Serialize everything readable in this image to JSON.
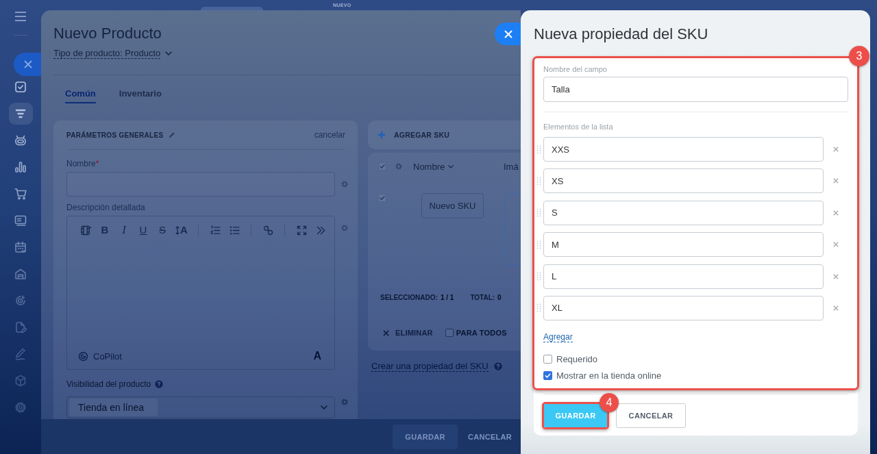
{
  "sidebar": {
    "items": [
      {
        "selected": false
      },
      {
        "selected": true
      },
      {
        "selected": false
      },
      {
        "selected": false
      },
      {
        "selected": false
      },
      {
        "selected": false
      },
      {
        "selected": false
      },
      {
        "selected": false
      },
      {
        "selected": false
      },
      {
        "selected": false
      },
      {
        "selected": false
      },
      {
        "selected": false
      },
      {
        "selected": false
      }
    ]
  },
  "top_bar": {
    "label": "NUEVO"
  },
  "product_form": {
    "title": "Nuevo Producto",
    "type_selector": "Tipo de producto: Producto",
    "tabs": [
      {
        "label": "Común",
        "selected": true
      },
      {
        "label": "Inventario",
        "selected": false
      }
    ],
    "general_parameters": {
      "title": "PARÁMETROS GENERALES",
      "cancel_link": "cancelar",
      "name_label": "Nombre",
      "required_mark": "*",
      "description_label": "Descripción detallada",
      "toolbar_glyphs": [
        {
          "kind": "bold",
          "label": "B"
        },
        {
          "kind": "italic",
          "label": "I"
        },
        {
          "kind": "underline",
          "label": "U"
        },
        {
          "kind": "strikethrough",
          "label": "S"
        },
        {
          "kind": "font_size",
          "label": "A"
        }
      ],
      "copilot": "CoPilot",
      "text_color_glyph": "A",
      "visibility_label": "Visibilidad del producto",
      "visibility_value": "Tienda en línea"
    },
    "sku": {
      "add_button": "AGREGAR SKU",
      "select_all_checked": true,
      "columns": [
        {
          "label": "Nombre",
          "sortable": true
        },
        {
          "label": "Imá",
          "sortable": false
        }
      ],
      "rows": [
        {
          "name": "Nuevo SKU",
          "checked": true
        }
      ],
      "selected_label": "SELECCIONADO:",
      "selected_value": "1 / 1",
      "total_label": "TOTAL:",
      "total_value": "0",
      "delete_button": {
        "label": "ELIMINAR",
        "disabled": true
      },
      "for_all": {
        "label": "PARA TODOS",
        "checked": false
      }
    },
    "create_property_link": "Crear una propiedad del SKU",
    "footer_buttons": [
      {
        "label": "GUARDAR",
        "kind": "primary"
      },
      {
        "label": "CANCELAR",
        "kind": "secondary"
      }
    ]
  },
  "property_panel": {
    "title": "Nueva propiedad del SKU",
    "form_callout": "3",
    "field_label": "Nombre del campo",
    "field_value": "Talla",
    "list_label": "Elementos de la lista",
    "list_items": [
      "XXS",
      "XS",
      "S",
      "M",
      "L",
      "XL"
    ],
    "add_link": "Agregar",
    "options": [
      {
        "label": "Requerido",
        "checked": false
      },
      {
        "label": "Mostrar en la tienda online",
        "checked": true
      }
    ],
    "buttons": [
      {
        "label": "GUARDAR",
        "kind": "primary",
        "callout": "4"
      },
      {
        "label": "CANCELAR",
        "kind": "secondary"
      }
    ]
  }
}
